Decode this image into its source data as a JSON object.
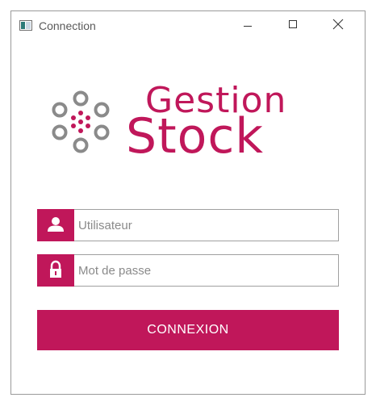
{
  "window": {
    "title": "Connection",
    "icon": "app-window-icon",
    "controls": {
      "minimize": "minimize-icon",
      "maximize": "maximize-icon",
      "close": "close-icon"
    }
  },
  "logo": {
    "line1": "Gestion",
    "line2": "Stock",
    "mark": "dots-circle-logo-icon"
  },
  "form": {
    "username": {
      "placeholder": "Utilisateur",
      "value": "",
      "icon": "user-icon"
    },
    "password": {
      "placeholder": "Mot de passe",
      "value": "",
      "icon": "lock-icon"
    },
    "submit_label": "CONNEXION"
  },
  "colors": {
    "accent": "#c0175a",
    "logo_gray": "#8a8a8a",
    "border": "#a0a0a0"
  }
}
